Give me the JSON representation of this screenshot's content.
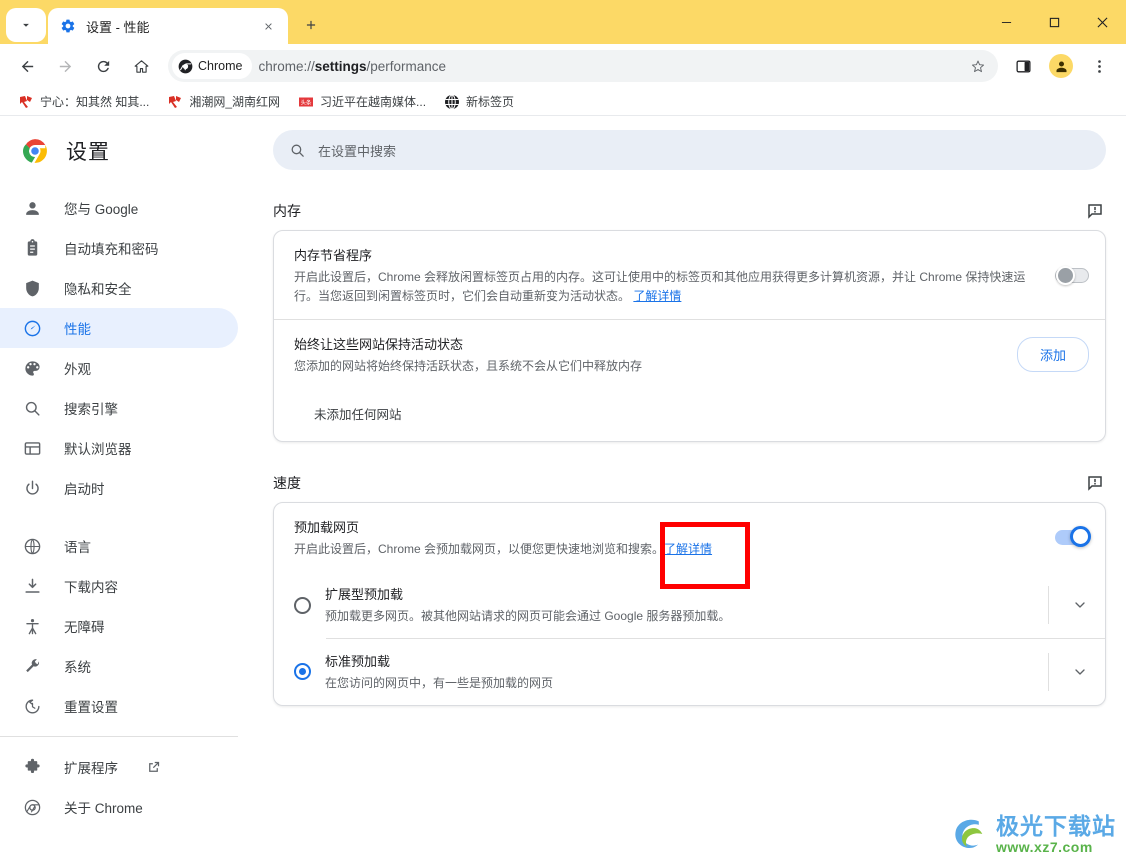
{
  "window": {
    "minimize_label": "最小化",
    "maximize_label": "最大化",
    "close_label": "关闭"
  },
  "tabstrip": {
    "tab_search_label": "搜索标签页",
    "new_tab_label": "新建标签页",
    "tabs": [
      {
        "title": "设置 - 性能",
        "favicon": "gear-icon",
        "active": true
      }
    ]
  },
  "toolbar": {
    "back_label": "返回",
    "forward_label": "前进",
    "reload_label": "重新加载",
    "home_label": "主页",
    "chip_label": "Chrome",
    "url_prefix": "chrome://",
    "url_bold": "settings",
    "url_suffix": "/performance",
    "bookmark_label": "为此标签页添加书签",
    "sidepanel_label": "侧边栏",
    "profile_label": "个人资料",
    "menu_label": "自定义及控制 Google Chrome"
  },
  "bookmarks": [
    {
      "label": "宁心：知其然 知其...",
      "icon": "site-icon-red"
    },
    {
      "label": "湘潮网_湖南红网",
      "icon": "site-icon-red"
    },
    {
      "label": "习近平在越南媒体...",
      "icon": "site-icon-toutiao"
    },
    {
      "label": "新标签页",
      "icon": "globe-dark-icon"
    }
  ],
  "settings": {
    "brand_title": "设置",
    "search": {
      "placeholder": "在设置中搜索",
      "value": "",
      "icon": "search-icon"
    },
    "sidebar": {
      "groups": [
        {
          "items": [
            {
              "label": "您与 Google",
              "icon": "person-icon",
              "active": false
            },
            {
              "label": "自动填充和密码",
              "icon": "clipboard-icon",
              "active": false
            },
            {
              "label": "隐私和安全",
              "icon": "shield-icon",
              "active": false
            },
            {
              "label": "性能",
              "icon": "speedometer-icon",
              "active": true
            },
            {
              "label": "外观",
              "icon": "palette-icon",
              "active": false
            },
            {
              "label": "搜索引擎",
              "icon": "search-icon",
              "active": false
            },
            {
              "label": "默认浏览器",
              "icon": "browser-window-icon",
              "active": false
            },
            {
              "label": "启动时",
              "icon": "power-icon",
              "active": false
            }
          ]
        },
        {
          "items": [
            {
              "label": "语言",
              "icon": "globe-icon",
              "active": false
            },
            {
              "label": "下载内容",
              "icon": "download-icon",
              "active": false
            },
            {
              "label": "无障碍",
              "icon": "accessibility-icon",
              "active": false
            },
            {
              "label": "系统",
              "icon": "wrench-icon",
              "active": false
            },
            {
              "label": "重置设置",
              "icon": "history-restore-icon",
              "active": false
            }
          ]
        },
        {
          "items": [
            {
              "label": "扩展程序",
              "icon": "puzzle-icon",
              "active": false,
              "external": true
            },
            {
              "label": "关于 Chrome",
              "icon": "chrome-outline-icon",
              "active": false
            }
          ]
        }
      ]
    },
    "sections": [
      {
        "id": "memory",
        "title": "内存",
        "feedback_icon": "feedback-icon",
        "rows": [
          {
            "type": "toggle",
            "title": "内存节省程序",
            "desc": "开启此设置后，Chrome 会释放闲置标签页占用的内存。这可让使用中的标签页和其他应用获得更多计算机资源，并让 Chrome 保持快速运行。当您返回到闲置标签页时，它们会自动重新变为活动状态。",
            "link": "了解详情",
            "toggle_on": false
          },
          {
            "type": "button",
            "title": "始终让这些网站保持活动状态",
            "desc": "您添加的网站将始终保持活跃状态，且系统不会从它们中释放内存",
            "button_label": "添加",
            "empty_label": "未添加任何网站"
          }
        ]
      },
      {
        "id": "speed",
        "title": "速度",
        "feedback_icon": "feedback-icon",
        "rows": [
          {
            "type": "toggle",
            "title": "预加载网页",
            "desc": "开启此设置后，Chrome 会预加载网页，以便您更快速地浏览和搜索。",
            "link": "了解详情",
            "toggle_on": true,
            "highlighted": true
          }
        ],
        "radios": [
          {
            "label": "扩展型预加载",
            "desc": "预加载更多网页。被其他网站请求的网页可能会通过 Google 服务器预加载。",
            "selected": false
          },
          {
            "label": "标准预加载",
            "desc": "在您访问的网页中，有一些是预加载的网页",
            "selected": true
          }
        ]
      }
    ]
  },
  "watermark": {
    "main": "极光下载站",
    "sub": "www.xz7.com"
  },
  "colors": {
    "tabstrip_yellow": "#fcd966",
    "accent_blue": "#1a73e8",
    "active_pill": "#e8f0fe",
    "highlight_red": "#ff0000",
    "search_bg": "#e9eef6"
  }
}
